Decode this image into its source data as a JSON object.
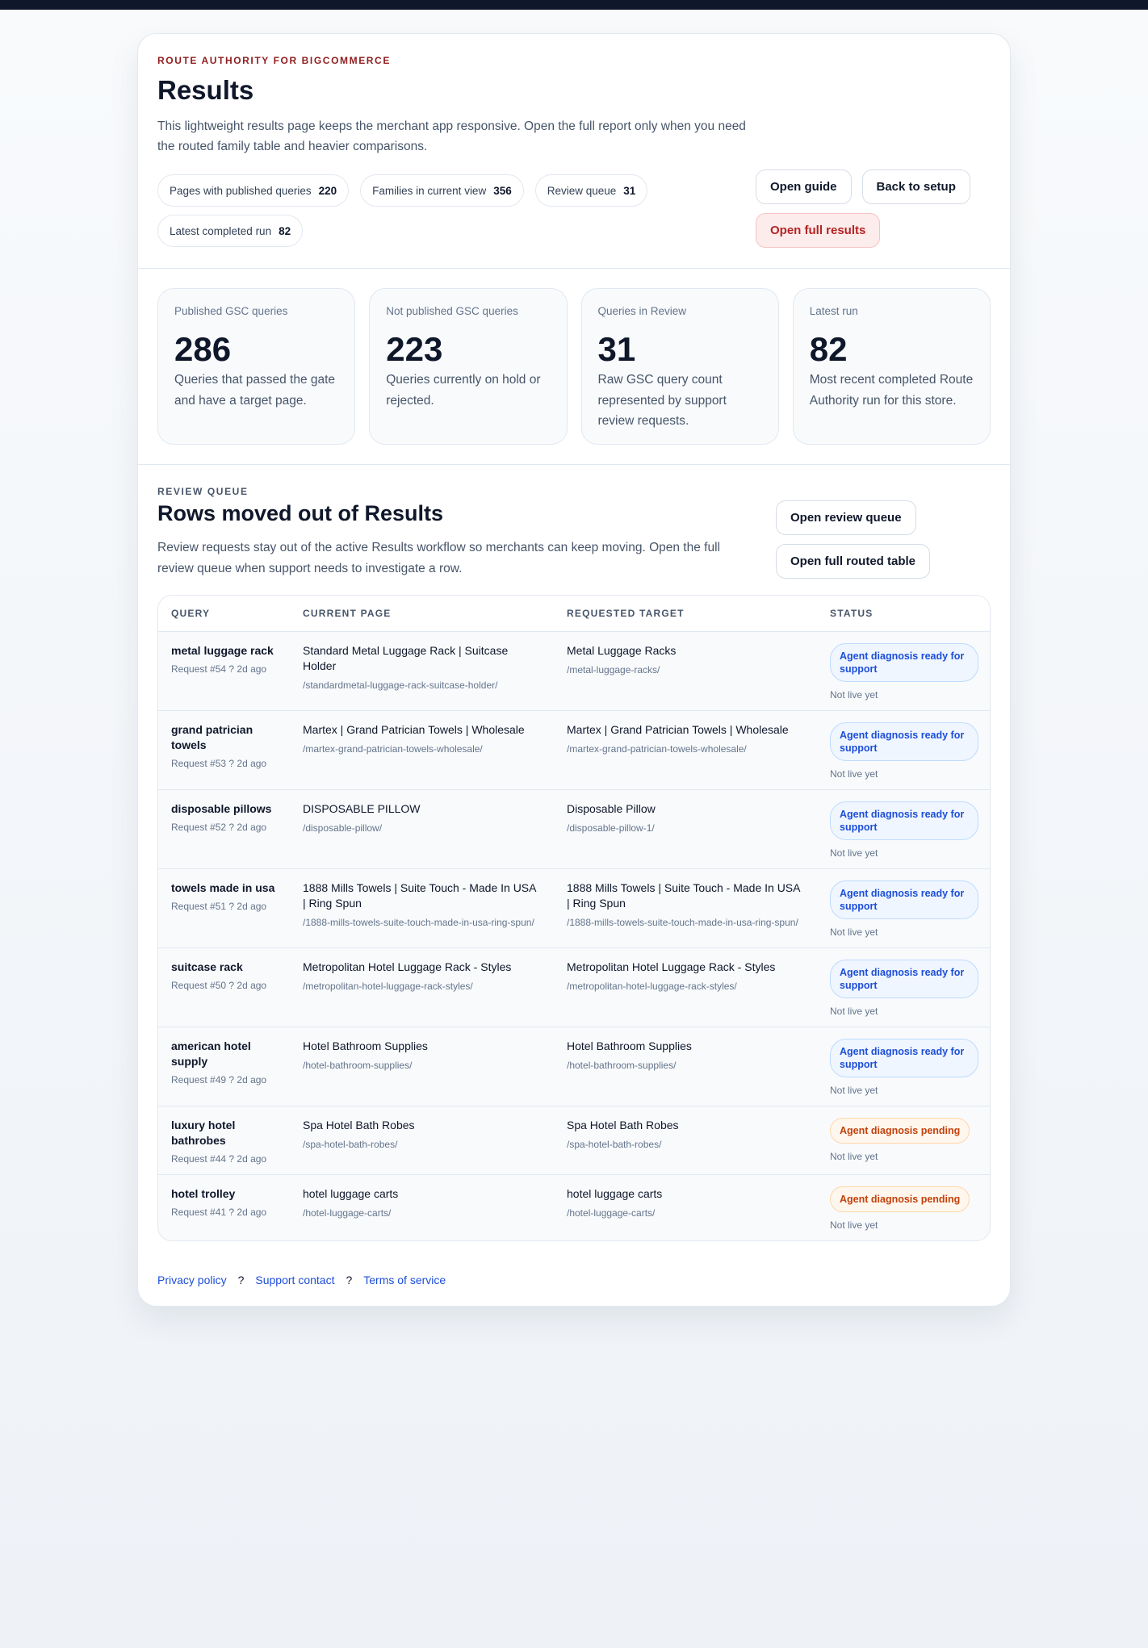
{
  "hero": {
    "eyebrow": "ROUTE AUTHORITY FOR BIGCOMMERCE",
    "title": "Results",
    "lede": "This lightweight results page keeps the merchant app responsive. Open the full report only when you need the routed family table and heavier comparisons.",
    "chips": [
      {
        "label": "Pages with published queries",
        "value": "220"
      },
      {
        "label": "Families in current view",
        "value": "356"
      },
      {
        "label": "Review queue",
        "value": "31"
      },
      {
        "label": "Latest completed run",
        "value": "82"
      }
    ],
    "actions": {
      "guide": "Open guide",
      "back": "Back to setup",
      "full": "Open full results"
    }
  },
  "stats": [
    {
      "label": "Published GSC queries",
      "value": "286",
      "desc": "Queries that passed the gate and have a target page."
    },
    {
      "label": "Not published GSC queries",
      "value": "223",
      "desc": "Queries currently on hold or rejected."
    },
    {
      "label": "Queries in Review",
      "value": "31",
      "desc": "Raw GSC query count represented by support review requests."
    },
    {
      "label": "Latest run",
      "value": "82",
      "desc": "Most recent completed Route Authority run for this store."
    }
  ],
  "review": {
    "eyebrow": "REVIEW QUEUE",
    "title": "Rows moved out of Results",
    "lede": "Review requests stay out of the active Results workflow so merchants can keep moving. Open the full review queue when support needs to investigate a row.",
    "actions": {
      "queue": "Open review queue",
      "table": "Open full routed table"
    },
    "columns": [
      "QUERY",
      "CURRENT PAGE",
      "REQUESTED TARGET",
      "STATUS"
    ],
    "rows": [
      {
        "query": "metal luggage rack",
        "meta": "Request #54 ? 2d ago",
        "current": "Standard Metal Luggage Rack | Suitcase Holder",
        "current_url": "/standardmetal-luggage-rack-suitcase-holder/",
        "target": "Metal Luggage Racks",
        "target_url": "/metal-luggage-racks/",
        "status": "Agent diagnosis ready for support",
        "status_kind": "ready",
        "live": "Not live yet"
      },
      {
        "query": "grand patrician towels",
        "meta": "Request #53 ? 2d ago",
        "current": "Martex | Grand Patrician Towels | Wholesale",
        "current_url": "/martex-grand-patrician-towels-wholesale/",
        "target": "Martex | Grand Patrician Towels | Wholesale",
        "target_url": "/martex-grand-patrician-towels-wholesale/",
        "status": "Agent diagnosis ready for support",
        "status_kind": "ready",
        "live": "Not live yet"
      },
      {
        "query": "disposable pillows",
        "meta": "Request #52 ? 2d ago",
        "current": "DISPOSABLE PILLOW",
        "current_url": "/disposable-pillow/",
        "target": "Disposable Pillow",
        "target_url": "/disposable-pillow-1/",
        "status": "Agent diagnosis ready for support",
        "status_kind": "ready",
        "live": "Not live yet"
      },
      {
        "query": "towels made in usa",
        "meta": "Request #51 ? 2d ago",
        "current": "1888 Mills Towels | Suite Touch - Made In USA | Ring Spun",
        "current_url": "/1888-mills-towels-suite-touch-made-in-usa-ring-spun/",
        "target": "1888 Mills Towels | Suite Touch - Made In USA | Ring Spun",
        "target_url": "/1888-mills-towels-suite-touch-made-in-usa-ring-spun/",
        "status": "Agent diagnosis ready for support",
        "status_kind": "ready",
        "live": "Not live yet"
      },
      {
        "query": "suitcase rack",
        "meta": "Request #50 ? 2d ago",
        "current": "Metropolitan Hotel Luggage Rack - Styles",
        "current_url": "/metropolitan-hotel-luggage-rack-styles/",
        "target": "Metropolitan Hotel Luggage Rack - Styles",
        "target_url": "/metropolitan-hotel-luggage-rack-styles/",
        "status": "Agent diagnosis ready for support",
        "status_kind": "ready",
        "live": "Not live yet"
      },
      {
        "query": "american hotel supply",
        "meta": "Request #49 ? 2d ago",
        "current": "Hotel Bathroom Supplies",
        "current_url": "/hotel-bathroom-supplies/",
        "target": "Hotel Bathroom Supplies",
        "target_url": "/hotel-bathroom-supplies/",
        "status": "Agent diagnosis ready for support",
        "status_kind": "ready",
        "live": "Not live yet"
      },
      {
        "query": "luxury hotel bathrobes",
        "meta": "Request #44 ? 2d ago",
        "current": "Spa Hotel Bath Robes",
        "current_url": "/spa-hotel-bath-robes/",
        "target": "Spa Hotel Bath Robes",
        "target_url": "/spa-hotel-bath-robes/",
        "status": "Agent diagnosis pending",
        "status_kind": "pending",
        "live": "Not live yet"
      },
      {
        "query": "hotel trolley",
        "meta": "Request #41 ? 2d ago",
        "current": "hotel luggage carts",
        "current_url": "/hotel-luggage-carts/",
        "target": "hotel luggage carts",
        "target_url": "/hotel-luggage-carts/",
        "status": "Agent diagnosis pending",
        "status_kind": "pending",
        "live": "Not live yet"
      }
    ]
  },
  "footer": {
    "privacy": "Privacy policy",
    "support": "Support contact",
    "terms": "Terms of service",
    "separator": "?"
  },
  "colors": {
    "accent": "#8f1d1d",
    "primary_button_text": "#b42323",
    "link": "#1d4ed8",
    "ready_badge": "#1d4ed8",
    "pending_badge": "#c2410c"
  }
}
